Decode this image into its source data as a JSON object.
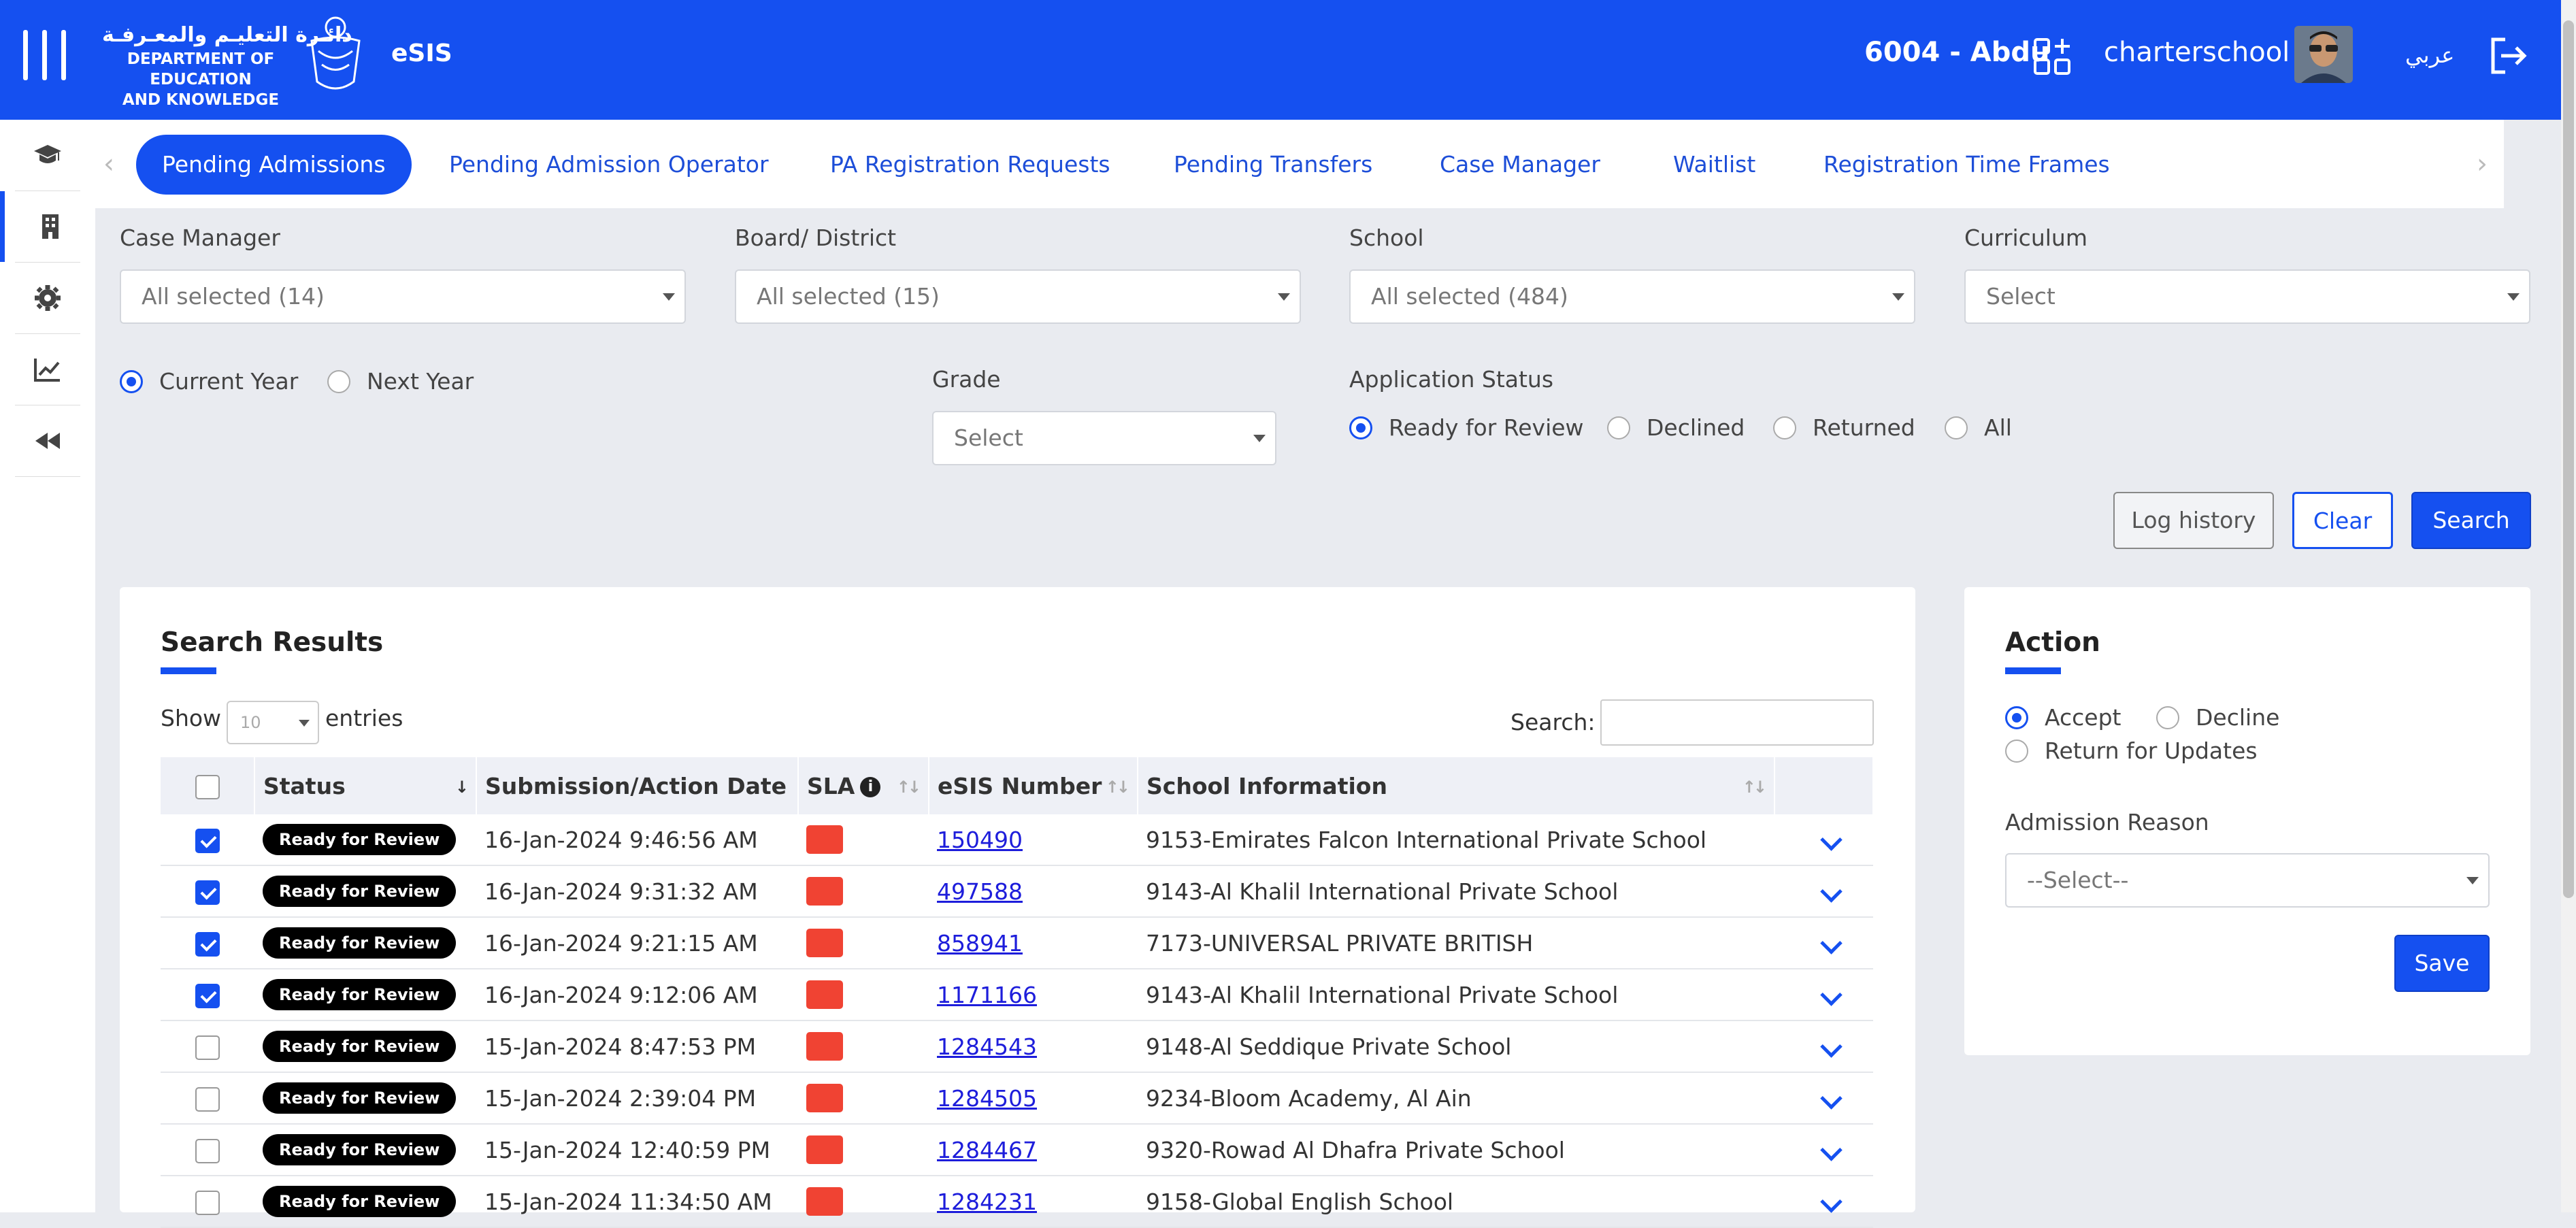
{
  "header": {
    "logo_arabic": "دائـرة التعليـم والمعـرفـة",
    "logo_english_line1": "DEPARTMENT OF EDUCATION",
    "logo_english_line2": "AND KNOWLEDGE",
    "app_name": "eSIS",
    "school_code": "6004 - Abdu",
    "username": "charterschool",
    "language_toggle": "عربي"
  },
  "sidebar": {
    "items": [
      {
        "icon": "graduation-cap-icon"
      },
      {
        "icon": "building-icon"
      },
      {
        "icon": "gear-icon"
      },
      {
        "icon": "chart-line-icon"
      },
      {
        "icon": "rewind-icon"
      }
    ]
  },
  "tabs": [
    {
      "label": "Pending Admissions",
      "active": true
    },
    {
      "label": "Pending Admission Operator"
    },
    {
      "label": "PA Registration Requests"
    },
    {
      "label": "Pending Transfers"
    },
    {
      "label": "Case Manager"
    },
    {
      "label": "Waitlist"
    },
    {
      "label": "Registration Time Frames"
    }
  ],
  "filters": {
    "case_manager": {
      "label": "Case Manager",
      "value": "All selected (14)"
    },
    "board_district": {
      "label": "Board/ District",
      "value": "All selected (15)"
    },
    "school": {
      "label": "School",
      "value": "All selected (484)"
    },
    "curriculum": {
      "label": "Curriculum",
      "value": "Select"
    },
    "year_options": [
      "Current Year",
      "Next Year"
    ],
    "year_selected": "Current Year",
    "grade": {
      "label": "Grade",
      "value": "Select"
    },
    "application_status": {
      "label": "Application Status",
      "options": [
        "Ready for Review",
        "Declined",
        "Returned",
        "All"
      ],
      "selected": "Ready for Review"
    }
  },
  "buttons": {
    "log_history": "Log history",
    "clear": "Clear",
    "search": "Search"
  },
  "results": {
    "title": "Search Results",
    "show_label": "Show",
    "page_size": "10",
    "entries_label": "entries",
    "search_label": "Search:",
    "search_value": "",
    "columns": [
      "Status",
      "Submission/Action Date",
      "SLA",
      "eSIS Number",
      "School Information"
    ],
    "rows": [
      {
        "checked": true,
        "status": "Ready for Review",
        "date": "16-Jan-2024 9:46:56 AM",
        "sla_color": "#f04333",
        "esis": "150490",
        "school": "9153-Emirates Falcon International Private School"
      },
      {
        "checked": true,
        "status": "Ready for Review",
        "date": "16-Jan-2024 9:31:32 AM",
        "sla_color": "#f04333",
        "esis": "497588",
        "school": "9143-Al Khalil International Private School"
      },
      {
        "checked": true,
        "status": "Ready for Review",
        "date": "16-Jan-2024 9:21:15 AM",
        "sla_color": "#f04333",
        "esis": "858941",
        "school": "7173-UNIVERSAL PRIVATE BRITISH"
      },
      {
        "checked": true,
        "status": "Ready for Review",
        "date": "16-Jan-2024 9:12:06 AM",
        "sla_color": "#f04333",
        "esis": "1171166",
        "school": "9143-Al Khalil International Private School"
      },
      {
        "checked": false,
        "status": "Ready for Review",
        "date": "15-Jan-2024 8:47:53 PM",
        "sla_color": "#f04333",
        "esis": "1284543",
        "school": "9148-Al Seddique Private School"
      },
      {
        "checked": false,
        "status": "Ready for Review",
        "date": "15-Jan-2024 2:39:04 PM",
        "sla_color": "#f04333",
        "esis": "1284505",
        "school": "9234-Bloom Academy, Al Ain"
      },
      {
        "checked": false,
        "status": "Ready for Review",
        "date": "15-Jan-2024 12:40:59 PM",
        "sla_color": "#f04333",
        "esis": "1284467",
        "school": "9320-Rowad Al Dhafra Private School"
      },
      {
        "checked": false,
        "status": "Ready for Review",
        "date": "15-Jan-2024 11:34:50 AM",
        "sla_color": "#f04333",
        "esis": "1284231",
        "school": "9158-Global English School"
      }
    ]
  },
  "action": {
    "title": "Action",
    "options": [
      "Accept",
      "Decline",
      "Return for Updates"
    ],
    "selected": "Accept",
    "reason_label": "Admission Reason",
    "reason_value": "--Select--",
    "save_label": "Save"
  },
  "colors": {
    "brand_blue": "#1550f0",
    "sla_red": "#f04333",
    "badge_black": "#000000"
  }
}
